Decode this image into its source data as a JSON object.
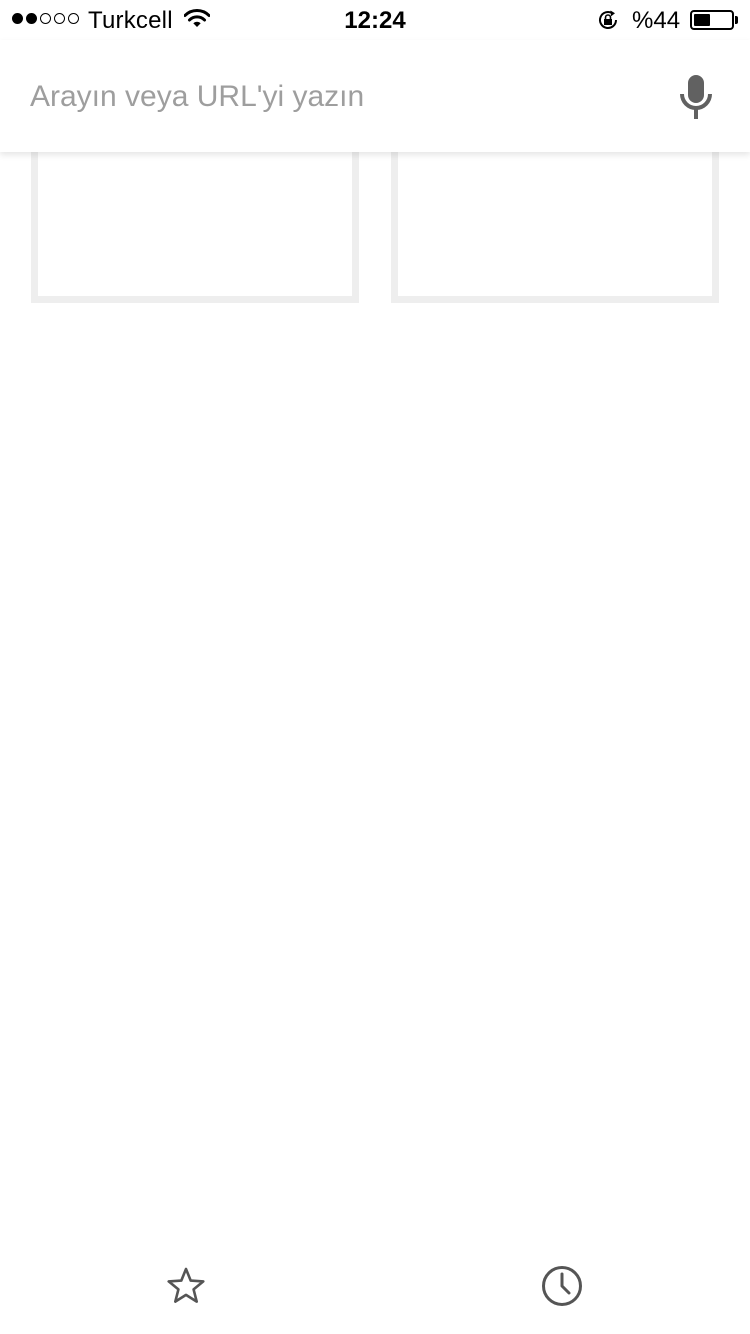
{
  "status_bar": {
    "signal_bars_filled": 2,
    "signal_bars_total": 5,
    "carrier": "Turkcell",
    "time": "12:24",
    "battery_text": "%44",
    "battery_level_percent": 44,
    "icons": [
      "wifi-icon",
      "rotation-lock-icon",
      "battery-icon"
    ]
  },
  "search": {
    "value": "",
    "placeholder": "Arayın veya URL'yi yazın",
    "voice_icon": "microphone-icon"
  },
  "tiles": [
    {
      "label": ""
    },
    {
      "label": ""
    }
  ],
  "toolbar": {
    "buttons": [
      {
        "icon": "star-icon"
      },
      {
        "icon": "clock-icon"
      }
    ]
  }
}
